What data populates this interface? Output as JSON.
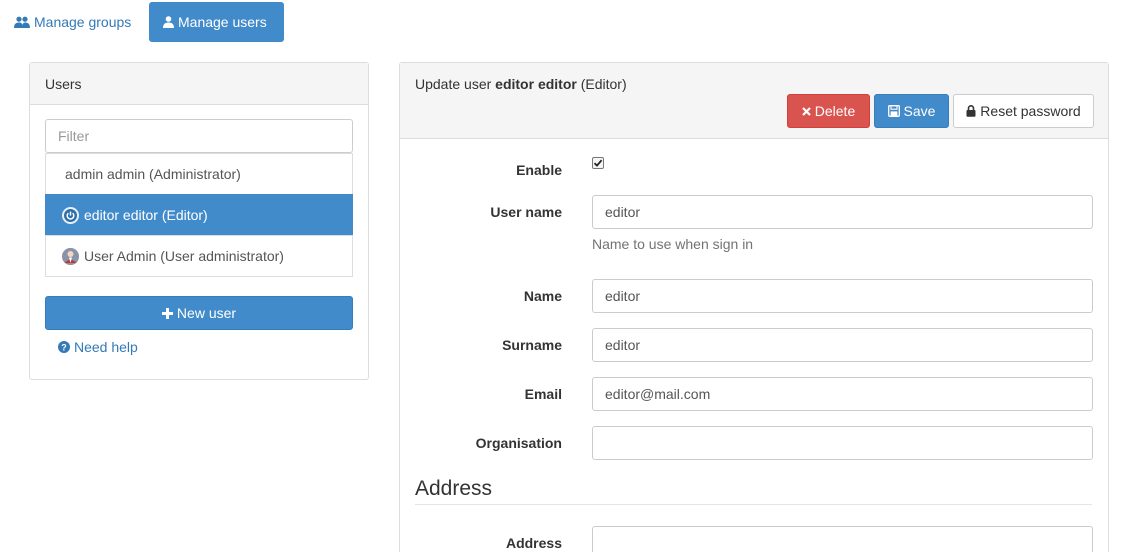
{
  "nav": {
    "groups_label": "Manage groups",
    "users_label": "Manage users",
    "groups_icon": "users-icon",
    "users_icon": "user-icon"
  },
  "users_panel": {
    "title": "Users",
    "filter_placeholder": "Filter",
    "items": [
      {
        "label": "admin admin (Administrator)",
        "icon": "",
        "active": false
      },
      {
        "label": "editor editor (Editor)",
        "icon": "power-icon",
        "active": true
      },
      {
        "label": "User Admin (User administrator)",
        "icon": "user-avatar-icon",
        "active": false
      }
    ],
    "new_user_label": "New user",
    "help_label": "Need help"
  },
  "edit_panel": {
    "title_prefix": "Update user",
    "title_user": "editor editor",
    "title_role": "(Editor)",
    "delete_label": "Delete",
    "save_label": "Save",
    "reset_label": "Reset password",
    "fields": {
      "enable_label": "Enable",
      "enable_checked": true,
      "username_label": "User name",
      "username_value": "editor",
      "username_help": "Name to use when sign in",
      "name_label": "Name",
      "name_value": "editor",
      "surname_label": "Surname",
      "surname_value": "editor",
      "email_label": "Email",
      "email_value": "editor@mail.com",
      "org_label": "Organisation",
      "org_value": ""
    },
    "address_section_title": "Address",
    "address_label": "Address",
    "address_value": ""
  },
  "colors": {
    "primary": "#428bca",
    "danger": "#d9534f",
    "link": "#337ab7"
  }
}
